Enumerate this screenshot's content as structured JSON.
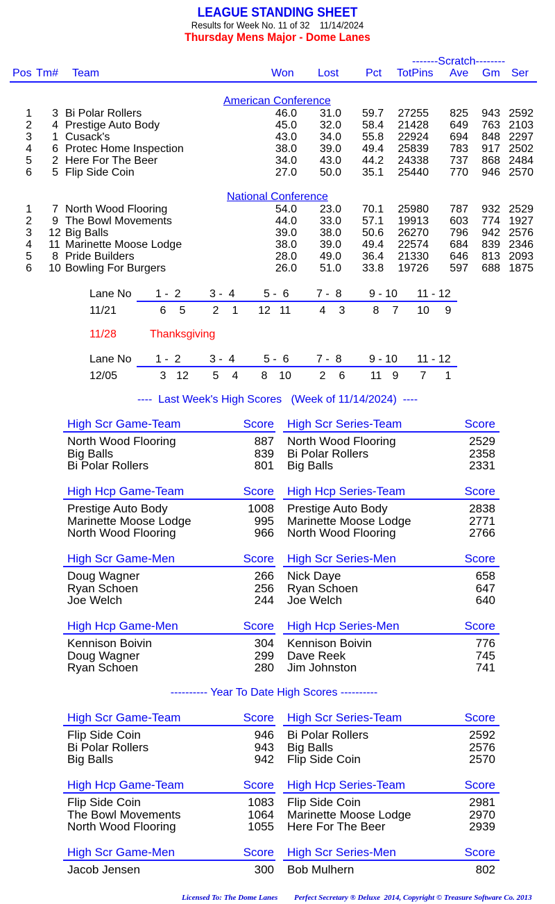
{
  "header": {
    "title": "LEAGUE STANDING SHEET",
    "subtitle": "Results for Week No. 11 of 32    11/14/2024",
    "league": "Thursday Mens Major - Dome Lanes"
  },
  "standings": {
    "scratch_label": "-------Scratch--------",
    "columns": [
      "Pos",
      "Tm#",
      "Team",
      "Won",
      "Lost",
      "Pct",
      "TotPins",
      "Ave",
      "Gm",
      "Ser"
    ],
    "conferences": [
      {
        "name": "American Conference",
        "rows": [
          {
            "pos": "1",
            "tm": "3",
            "team": "Bi Polar Rollers",
            "won": "46.0",
            "lost": "31.0",
            "pct": "59.7",
            "totpins": "27255",
            "ave": "825",
            "gm": "943",
            "ser": "2592"
          },
          {
            "pos": "2",
            "tm": "4",
            "team": "Prestige Auto Body",
            "won": "45.0",
            "lost": "32.0",
            "pct": "58.4",
            "totpins": "21428",
            "ave": "649",
            "gm": "763",
            "ser": "2103"
          },
          {
            "pos": "3",
            "tm": "1",
            "team": "Cusack's",
            "won": "43.0",
            "lost": "34.0",
            "pct": "55.8",
            "totpins": "22924",
            "ave": "694",
            "gm": "848",
            "ser": "2297"
          },
          {
            "pos": "4",
            "tm": "6",
            "team": "Protec Home Inspection",
            "won": "38.0",
            "lost": "39.0",
            "pct": "49.4",
            "totpins": "25839",
            "ave": "783",
            "gm": "917",
            "ser": "2502"
          },
          {
            "pos": "5",
            "tm": "2",
            "team": "Here For The Beer",
            "won": "34.0",
            "lost": "43.0",
            "pct": "44.2",
            "totpins": "24338",
            "ave": "737",
            "gm": "868",
            "ser": "2484"
          },
          {
            "pos": "6",
            "tm": "5",
            "team": "Flip Side Coin",
            "won": "27.0",
            "lost": "50.0",
            "pct": "35.1",
            "totpins": "25440",
            "ave": "770",
            "gm": "946",
            "ser": "2570"
          }
        ]
      },
      {
        "name": "National Conference",
        "rows": [
          {
            "pos": "1",
            "tm": "7",
            "team": "North Wood Flooring",
            "won": "54.0",
            "lost": "23.0",
            "pct": "70.1",
            "totpins": "25980",
            "ave": "787",
            "gm": "932",
            "ser": "2529"
          },
          {
            "pos": "2",
            "tm": "9",
            "team": "The Bowl Movements",
            "won": "44.0",
            "lost": "33.0",
            "pct": "57.1",
            "totpins": "19913",
            "ave": "603",
            "gm": "774",
            "ser": "1927"
          },
          {
            "pos": "3",
            "tm": "12",
            "team": "Big Balls",
            "won": "39.0",
            "lost": "38.0",
            "pct": "50.6",
            "totpins": "26270",
            "ave": "796",
            "gm": "942",
            "ser": "2576"
          },
          {
            "pos": "4",
            "tm": "11",
            "team": "Marinette Moose Lodge",
            "won": "38.0",
            "lost": "39.0",
            "pct": "49.4",
            "totpins": "22574",
            "ave": "684",
            "gm": "839",
            "ser": "2346"
          },
          {
            "pos": "5",
            "tm": "8",
            "team": "Pride Builders",
            "won": "28.0",
            "lost": "49.0",
            "pct": "36.4",
            "totpins": "21330",
            "ave": "646",
            "gm": "813",
            "ser": "2093"
          },
          {
            "pos": "6",
            "tm": "10",
            "team": "Bowling For Burgers",
            "won": "26.0",
            "lost": "51.0",
            "pct": "33.8",
            "totpins": "19726",
            "ave": "597",
            "gm": "688",
            "ser": "1875"
          }
        ]
      }
    ]
  },
  "schedule": {
    "lane_label": "Lane No",
    "lanes": [
      "1 -  2",
      "3 -  4",
      "5 -  6",
      "7 -  8",
      "9 - 10",
      "11 - 12"
    ],
    "weeks": [
      {
        "date": "11/21",
        "pairs": [
          [
            "6",
            "5"
          ],
          [
            "2",
            "1"
          ],
          [
            "12",
            "11"
          ],
          [
            "4",
            "3"
          ],
          [
            "8",
            "7"
          ],
          [
            "10",
            "9"
          ]
        ]
      },
      {
        "date": "12/05",
        "pairs": [
          [
            "3",
            "12"
          ],
          [
            "5",
            "4"
          ],
          [
            "8",
            "10"
          ],
          [
            "2",
            "6"
          ],
          [
            "11",
            "9"
          ],
          [
            "7",
            "1"
          ]
        ]
      }
    ],
    "holiday": {
      "date": "11/28",
      "label": "Thanksgiving"
    }
  },
  "last_week": {
    "title": "----  Last Week's High Scores   (Week of 11/14/2024)  ----",
    "score_label": "Score",
    "boxes": [
      {
        "title": "High Scr Game-Team",
        "items": [
          {
            "name": "North Wood Flooring",
            "score": "887"
          },
          {
            "name": "Big Balls",
            "score": "839"
          },
          {
            "name": "Bi Polar Rollers",
            "score": "801"
          }
        ]
      },
      {
        "title": "High Scr Series-Team",
        "items": [
          {
            "name": "North Wood Flooring",
            "score": "2529"
          },
          {
            "name": "Bi Polar Rollers",
            "score": "2358"
          },
          {
            "name": "Big Balls",
            "score": "2331"
          }
        ]
      },
      {
        "title": "High Hcp Game-Team",
        "items": [
          {
            "name": "Prestige Auto Body",
            "score": "1008"
          },
          {
            "name": "Marinette Moose Lodge",
            "score": "995"
          },
          {
            "name": "North Wood Flooring",
            "score": "966"
          }
        ]
      },
      {
        "title": "High Hcp Series-Team",
        "items": [
          {
            "name": "Prestige Auto Body",
            "score": "2838"
          },
          {
            "name": "Marinette Moose Lodge",
            "score": "2771"
          },
          {
            "name": "North Wood Flooring",
            "score": "2766"
          }
        ]
      },
      {
        "title": "High Scr Game-Men",
        "items": [
          {
            "name": "Doug Wagner",
            "score": "266"
          },
          {
            "name": "Ryan Schoen",
            "score": "256"
          },
          {
            "name": "Joe Welch",
            "score": "244"
          }
        ]
      },
      {
        "title": "High Scr Series-Men",
        "items": [
          {
            "name": "Nick Daye",
            "score": "658"
          },
          {
            "name": "Ryan Schoen",
            "score": "647"
          },
          {
            "name": "Joe Welch",
            "score": "640"
          }
        ]
      },
      {
        "title": "High Hcp Game-Men",
        "items": [
          {
            "name": "Kennison Boivin",
            "score": "304"
          },
          {
            "name": "Doug Wagner",
            "score": "299"
          },
          {
            "name": "Ryan Schoen",
            "score": "280"
          }
        ]
      },
      {
        "title": "High Hcp Series-Men",
        "items": [
          {
            "name": "Kennison Boivin",
            "score": "776"
          },
          {
            "name": "Dave Reek",
            "score": "745"
          },
          {
            "name": "Jim Johnston",
            "score": "741"
          }
        ]
      }
    ]
  },
  "ytd": {
    "title": "---------- Year To Date High Scores ----------",
    "score_label": "Score",
    "boxes": [
      {
        "title": "High Scr Game-Team",
        "items": [
          {
            "name": "Flip Side Coin",
            "score": "946"
          },
          {
            "name": "Bi Polar Rollers",
            "score": "943"
          },
          {
            "name": "Big Balls",
            "score": "942"
          }
        ]
      },
      {
        "title": "High Scr Series-Team",
        "items": [
          {
            "name": "Bi Polar Rollers",
            "score": "2592"
          },
          {
            "name": "Big Balls",
            "score": "2576"
          },
          {
            "name": "Flip Side Coin",
            "score": "2570"
          }
        ]
      },
      {
        "title": "High Hcp Game-Team",
        "items": [
          {
            "name": "Flip Side Coin",
            "score": "1083"
          },
          {
            "name": "The Bowl Movements",
            "score": "1064"
          },
          {
            "name": "North Wood Flooring",
            "score": "1055"
          }
        ]
      },
      {
        "title": "High Hcp Series-Team",
        "items": [
          {
            "name": "Flip Side Coin",
            "score": "2981"
          },
          {
            "name": "Marinette Moose Lodge",
            "score": "2970"
          },
          {
            "name": "Here For The Beer",
            "score": "2939"
          }
        ]
      },
      {
        "title": "High Scr Game-Men",
        "items": [
          {
            "name": "Jacob Jensen",
            "score": "300"
          }
        ]
      },
      {
        "title": "High Scr Series-Men",
        "items": [
          {
            "name": "Bob Mulhern",
            "score": "802"
          }
        ]
      }
    ]
  },
  "footer": {
    "licensed": "Licensed To: The Dome Lanes",
    "copyright": "Perfect Secretary ® Deluxe  2014, Copyright © Treasure Software Co. 2013"
  }
}
